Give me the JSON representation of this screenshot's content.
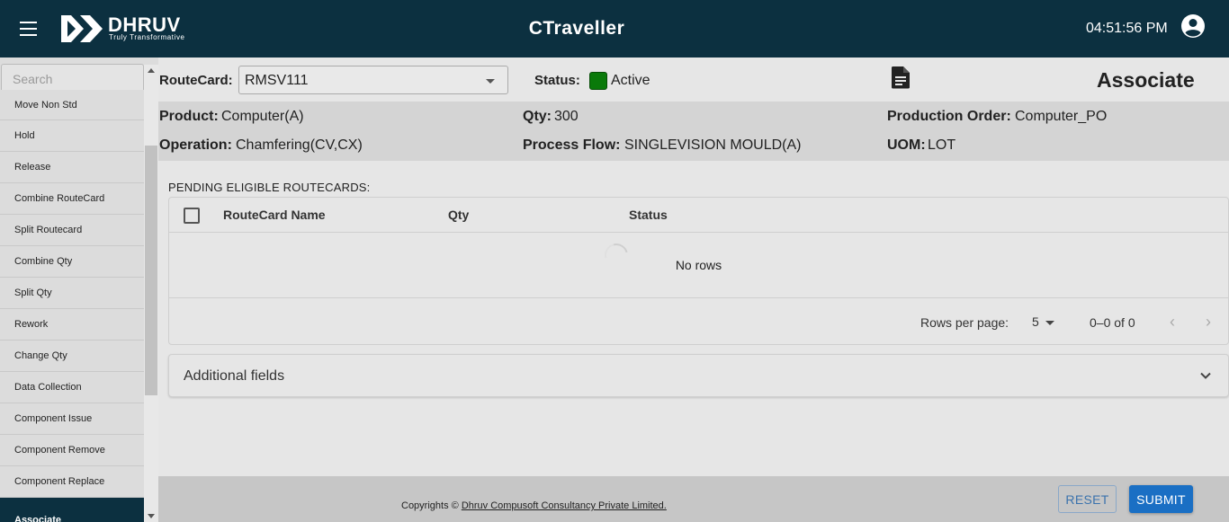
{
  "header": {
    "brand_name": "DHRUV",
    "brand_tagline": "Truly Transformative",
    "app_title": "CTraveller",
    "clock": "04:51:56 PM",
    "icons": {
      "menu": "hamburger-menu-icon",
      "user": "account-circle-icon"
    }
  },
  "sidebar": {
    "search_placeholder": "Search",
    "items": [
      {
        "label": "Move Non Std"
      },
      {
        "label": "Hold"
      },
      {
        "label": "Release"
      },
      {
        "label": "Combine RouteCard"
      },
      {
        "label": "Split Routecard"
      },
      {
        "label": "Combine Qty"
      },
      {
        "label": "Split Qty"
      },
      {
        "label": "Rework"
      },
      {
        "label": "Change Qty"
      },
      {
        "label": "Data Collection"
      },
      {
        "label": "Component Issue"
      },
      {
        "label": "Component Remove"
      },
      {
        "label": "Component Replace"
      },
      {
        "label": "Associate",
        "active": true
      }
    ]
  },
  "routecard": {
    "label": "RouteCard:",
    "value": "RMSV111",
    "status_label": "Status:",
    "status_value": "Active",
    "status_color": "#0a7a0a"
  },
  "page_heading": "Associate",
  "details": {
    "product_label": "Product:",
    "product_value": "Computer(A)",
    "qty_label": "Qty:",
    "qty_value": "300",
    "po_label": "Production Order:",
    "po_value": "Computer_PO",
    "operation_label": "Operation:",
    "operation_value": "Chamfering(CV,CX)",
    "flow_label": "Process Flow:",
    "flow_value": "SINGLEVISION MOULD(A)",
    "uom_label": "UOM:",
    "uom_value": "LOT"
  },
  "pending": {
    "title": "PENDING ELIGIBLE ROUTECARDS:",
    "columns": [
      "RouteCard Name",
      "Qty",
      "Status"
    ],
    "rows": [],
    "empty_text": "No rows",
    "rows_per_page_label": "Rows per page:",
    "rows_per_page_value": "5",
    "range_text": "0–0 of 0"
  },
  "additional_fields": {
    "label": "Additional fields"
  },
  "footer": {
    "copyright_prefix": "Copyrights ©",
    "company": "Dhruv Compusoft Consultancy Private Limited.",
    "reset_label": "RESET",
    "submit_label": "SUBMIT"
  },
  "colors": {
    "header_bg": "#0c3040",
    "accent": "#1a6fc4",
    "status_active": "#0a7a0a"
  }
}
